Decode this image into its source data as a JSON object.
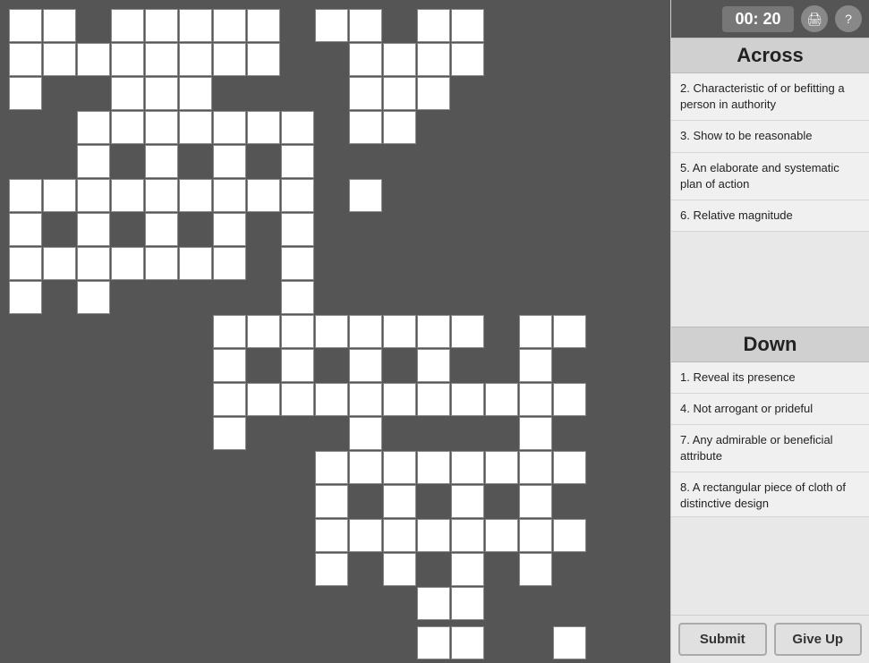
{
  "timer": {
    "display": "00: 20"
  },
  "icons": {
    "print": "🖨",
    "help": "?"
  },
  "across": {
    "header": "Across",
    "clues": [
      {
        "number": "2",
        "text": "Characteristic of or befitting a person in authority"
      },
      {
        "number": "3",
        "text": "Show to be reasonable"
      },
      {
        "number": "5",
        "text": "An elaborate and systematic plan of action"
      },
      {
        "number": "6",
        "text": "Relative magnitude"
      }
    ]
  },
  "down": {
    "header": "Down",
    "clues": [
      {
        "number": "1",
        "text": "Reveal its presence"
      },
      {
        "number": "4",
        "text": "Not arrogant or prideful"
      },
      {
        "number": "7",
        "text": "Any admirable or beneficial attribute"
      },
      {
        "number": "8",
        "text": "A rectangular piece of cloth of distinctive design"
      }
    ]
  },
  "buttons": {
    "submit": "Submit",
    "giveup": "Give Up"
  }
}
